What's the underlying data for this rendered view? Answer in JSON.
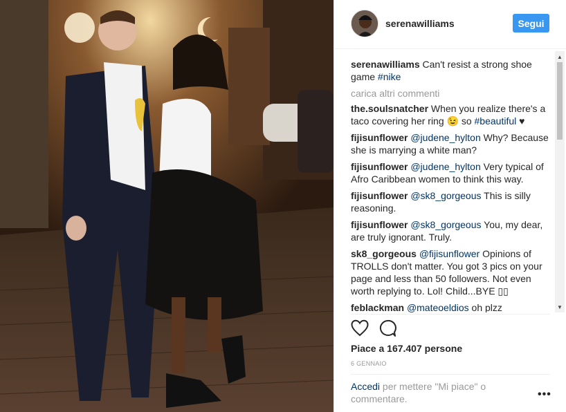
{
  "post": {
    "account": "serenawilliams",
    "follow_label": "Segui",
    "caption": {
      "user": "serenawilliams",
      "text": "Can't resist a strong shoe game ",
      "hashtag": "#nike"
    },
    "load_more": "carica altri commenti",
    "comments": [
      {
        "user": "the.soulsnatcher",
        "mention": "",
        "text": "When you realize there's a taco covering her ring 😉 so ",
        "hashtag": "#beautiful",
        "suffix": " ♥"
      },
      {
        "user": "fijisunflower",
        "mention": "@judene_hylton",
        "text": " Why? Because she is marrying a white man?",
        "hashtag": "",
        "suffix": ""
      },
      {
        "user": "fijisunflower",
        "mention": "@judene_hylton",
        "text": " Very typical of Afro Caribbean women to think this way.",
        "hashtag": "",
        "suffix": ""
      },
      {
        "user": "fijisunflower",
        "mention": "@sk8_gorgeous",
        "text": " This is silly reasoning.",
        "hashtag": "",
        "suffix": ""
      },
      {
        "user": "fijisunflower",
        "mention": "@sk8_gorgeous",
        "text": " You, my dear, are truly ignorant. Truly.",
        "hashtag": "",
        "suffix": ""
      },
      {
        "user": "sk8_gorgeous",
        "mention": "@fijisunflower",
        "text": " Opinions of TROLLS don't matter. You got 3 pics on your page and less than 50 followers. Not even worth replying to. Lol! Child...BYE ▯▯",
        "hashtag": "",
        "suffix": ""
      },
      {
        "user": "feblackman",
        "mention": "@mateoeldios",
        "text": " oh plzz",
        "hashtag": "",
        "suffix": ""
      }
    ],
    "likes": "Piace a 167.407 persone",
    "date": "6 GENNAIO",
    "login": {
      "link": "Accedi",
      "text": " per mettere \"Mi piace\" o commentare."
    },
    "more_label": "•••",
    "icons": {
      "like": "heart-icon",
      "comment": "comment-icon"
    },
    "colors": {
      "accent": "#3897f0",
      "link": "#003569",
      "muted": "#999999"
    }
  }
}
